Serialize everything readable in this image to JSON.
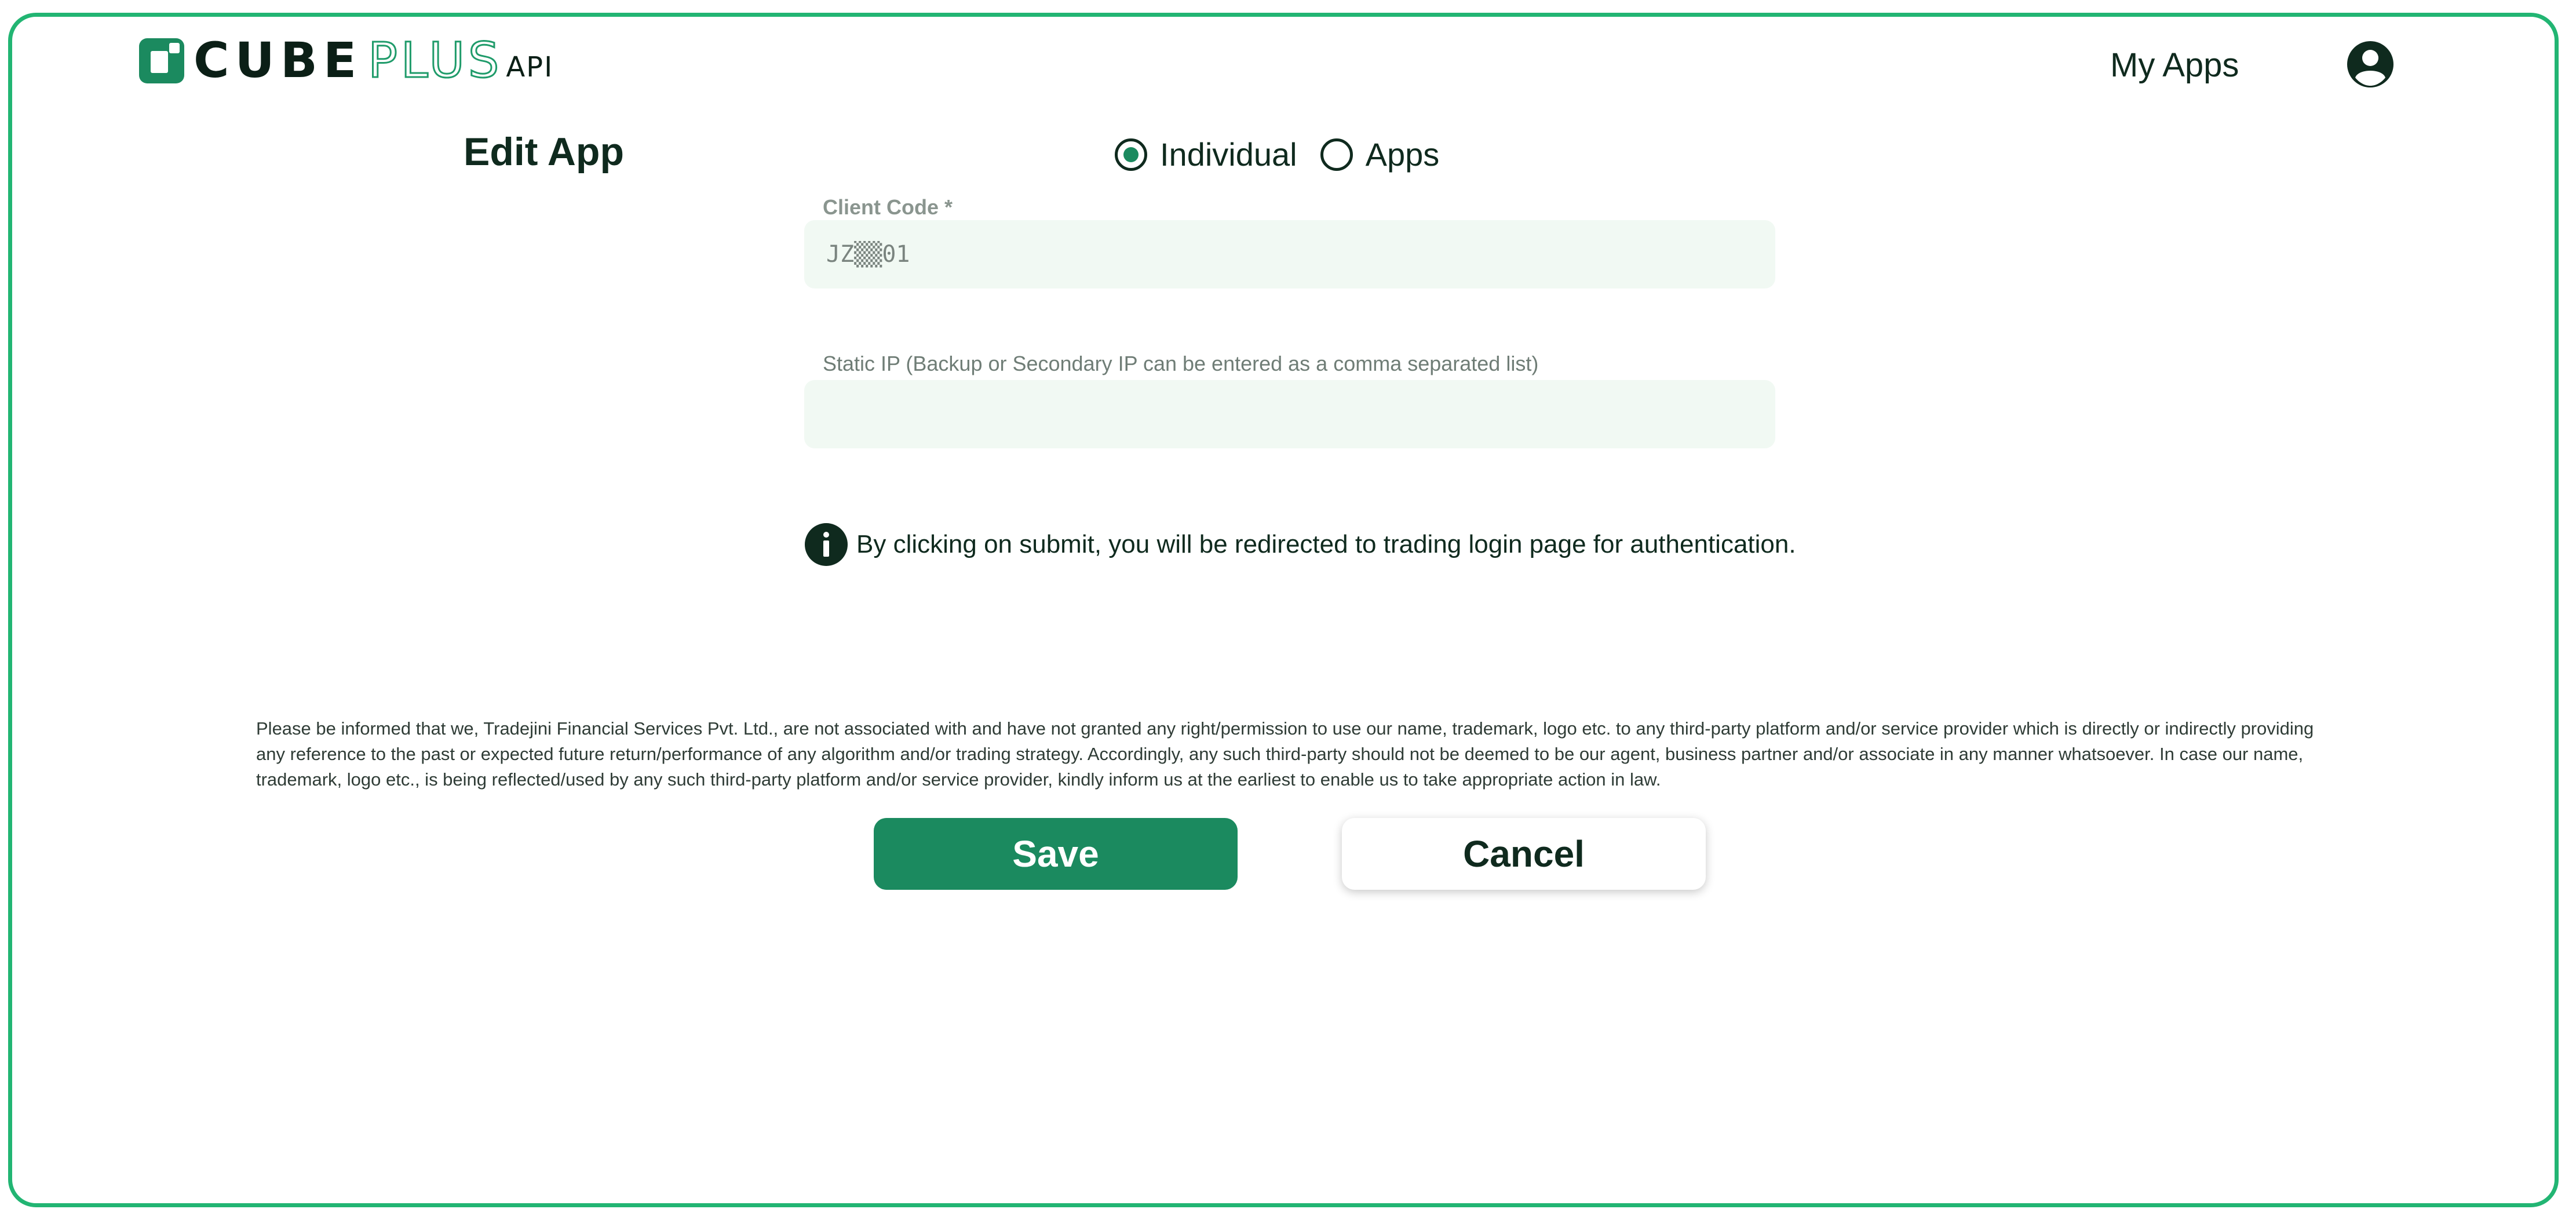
{
  "header": {
    "logo": {
      "part1": "CUBE",
      "part2": "PLUS",
      "part3": "API"
    },
    "nav_my_apps": "My Apps",
    "avatar_icon": "user-circle-icon"
  },
  "page": {
    "title": "Edit App"
  },
  "app_type": {
    "options": [
      {
        "label": "Individual",
        "selected": true
      },
      {
        "label": "Apps",
        "selected": false
      }
    ]
  },
  "form": {
    "client_code": {
      "label": "Client Code  *",
      "value": "JZ▒▒01"
    },
    "static_ip": {
      "label": "Static IP (Backup or Secondary IP can be entered as a comma separated list)",
      "value": ""
    },
    "info_icon": "info-icon",
    "info_text": "By clicking on submit, you will be redirected to trading login page for authentication."
  },
  "disclaimer": "Please be informed that we, Tradejini Financial Services Pvt. Ltd., are not associated with and have not granted any right/permission to use our name, trademark, logo etc. to any third-party platform and/or service provider which is directly or indirectly providing any reference to the past or expected future return/performance of any algorithm and/or trading strategy. Accordingly, any such third-party should not be deemed to be our agent, business partner and/or associate in any manner whatsoever. In case our name, trademark, logo etc., is being reflected/used by any such third-party platform and/or service provider, kindly inform us at the earliest to enable us to take appropriate action in law.",
  "actions": {
    "save_label": "Save",
    "cancel_label": "Cancel"
  },
  "colors": {
    "accent": "#1b8a5f",
    "frame_border": "#22b573",
    "field_bg": "#f1f9f3",
    "text_dark": "#0f2a1e"
  }
}
